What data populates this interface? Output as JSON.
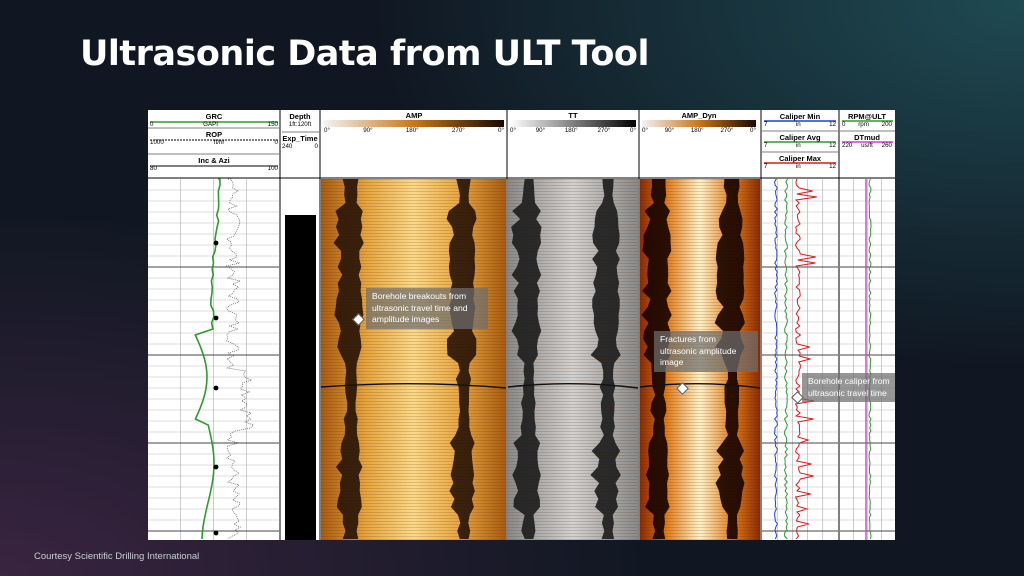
{
  "slide": {
    "title": "Ultrasonic Data from ULT Tool",
    "credit": "Courtesy Scientific Drilling International"
  },
  "header": {
    "grc": {
      "name": "GRC",
      "min": "0",
      "unit": "GAPI",
      "max": "150"
    },
    "rop": {
      "name": "ROP",
      "min": "1000",
      "unit": "ft/hr",
      "max": "0"
    },
    "incazi": {
      "name": "Inc & Azi",
      "min": "80",
      "max": "100"
    },
    "depth": {
      "name": "Depth",
      "scale": "1ft:120ft"
    },
    "exptime": {
      "name": "Exp_Time",
      "min": "240",
      "max": "0"
    },
    "amp": {
      "name": "AMP",
      "ticks": [
        "0°",
        "90°",
        "180°",
        "270°",
        "0°"
      ]
    },
    "tt": {
      "name": "TT",
      "ticks": [
        "0°",
        "90°",
        "180°",
        "270°",
        "0°"
      ]
    },
    "ampdyn": {
      "name": "AMP_Dyn",
      "ticks": [
        "0°",
        "90°",
        "180°",
        "270°",
        "0°"
      ]
    },
    "calmin": {
      "name": "Caliper Min",
      "min": "7",
      "unit": "in",
      "max": "12"
    },
    "calavg": {
      "name": "Caliper Avg",
      "min": "7",
      "unit": "in",
      "max": "12"
    },
    "calmax": {
      "name": "Caliper Max",
      "min": "7",
      "unit": "in",
      "max": "12"
    },
    "rpm": {
      "name": "RPM@ULT",
      "min": "0",
      "unit": "rpm",
      "max": "200"
    },
    "dtmud": {
      "name": "DTmud",
      "min": "220",
      "unit": "us/ft",
      "max": "260"
    }
  },
  "callouts": {
    "breakouts": "Borehole breakouts from ultrasonic travel time and amplitude images",
    "fractures": "Fractures from ultrasonic amplitude image",
    "caliper": "Borehole caliper from ultrasonic travel time"
  },
  "colors": {
    "grc_curve": "#2e9a2e",
    "caliper_min": "#1f3fd8",
    "caliper_avg": "#2e9a2e",
    "caliper_max": "#e01818",
    "rpm": "#2e9a2e",
    "dtmud": "#d63ad6",
    "amp_light": "#f5c76a",
    "amp_dark": "#2a1608"
  }
}
